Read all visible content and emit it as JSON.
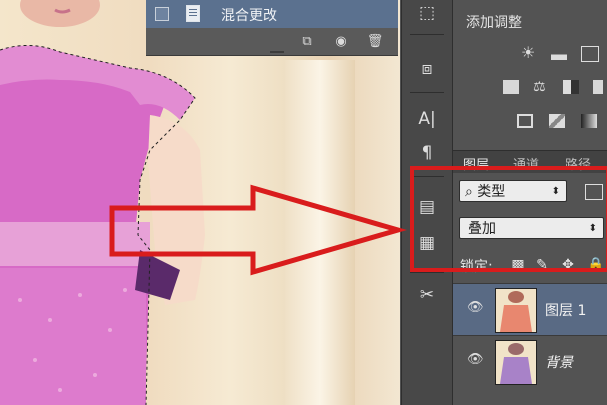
{
  "history": {
    "step_label": "混合更改"
  },
  "adjustments": {
    "title": "添加调整"
  },
  "layers_panel": {
    "tabs": [
      "图层",
      "通道",
      "路径"
    ],
    "filter_kind": "类型",
    "blend_mode": "叠加",
    "lock_label": "锁定:",
    "layers": [
      {
        "name": "图层 1",
        "selected": true
      },
      {
        "name": "背景",
        "selected": false
      }
    ]
  },
  "colors": {
    "annotation_red": "#d91c1c",
    "selection_blue": "#596a84",
    "dress_pink": "#d96fc8"
  }
}
